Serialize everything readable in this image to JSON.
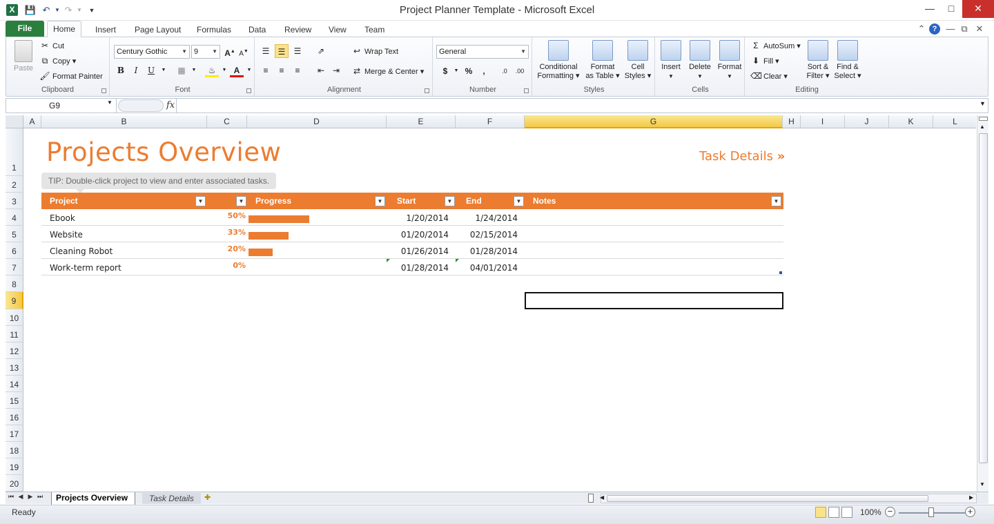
{
  "window": {
    "title": "Project Planner Template  -  Microsoft Excel"
  },
  "ribbon_tabs": [
    "File",
    "Home",
    "Insert",
    "Page Layout",
    "Formulas",
    "Data",
    "Review",
    "View",
    "Team"
  ],
  "clipboard": {
    "paste": "Paste",
    "cut": "Cut",
    "copy": "Copy",
    "format_painter": "Format Painter",
    "label": "Clipboard"
  },
  "font": {
    "name": "Century Gothic",
    "size": "9",
    "label": "Font",
    "bold": "B",
    "italic": "I",
    "underline": "U"
  },
  "alignment": {
    "wrap": "Wrap Text",
    "merge": "Merge & Center",
    "label": "Alignment"
  },
  "number": {
    "format": "General",
    "currency": "$",
    "percent": "%",
    "comma": ",",
    "label": "Number"
  },
  "styles": {
    "conditional": "Conditional",
    "conditional2": "Formatting",
    "format_table": "Format",
    "format_table2": "as Table",
    "cell_styles": "Cell",
    "cell_styles2": "Styles",
    "label": "Styles"
  },
  "cells": {
    "insert": "Insert",
    "delete": "Delete",
    "format": "Format",
    "label": "Cells"
  },
  "editing": {
    "autosum": "AutoSum",
    "fill": "Fill",
    "clear": "Clear",
    "sort": "Sort &",
    "sort2": "Filter",
    "find": "Find &",
    "find2": "Select",
    "label": "Editing"
  },
  "formula_bar": {
    "name_box": "G9",
    "fx": "fx",
    "value": ""
  },
  "columns": [
    "A",
    "B",
    "C",
    "D",
    "E",
    "F",
    "G",
    "H",
    "I",
    "J",
    "K",
    "L"
  ],
  "rows": [
    "1",
    "2",
    "3",
    "4",
    "5",
    "6",
    "7",
    "8",
    "9",
    "10",
    "11",
    "12",
    "13",
    "14",
    "15",
    "16",
    "17",
    "18",
    "19",
    "20"
  ],
  "sheet": {
    "title": "Projects Overview",
    "task_link": "Task Details",
    "task_link_arrow": "»",
    "tip": "TIP: Double-click project to view and enter associated tasks.",
    "headers": {
      "project": "Project",
      "progress": "Progress",
      "start": "Start",
      "end": "End",
      "notes": "Notes"
    },
    "projects": [
      {
        "name": "Ebook",
        "pct_label": "50%",
        "progress": 0.5,
        "start": "1/20/2014",
        "end": "1/24/2014"
      },
      {
        "name": "Website",
        "pct_label": "33%",
        "progress": 0.33,
        "start": "01/20/2014",
        "end": "02/15/2014"
      },
      {
        "name": "Cleaning Robot",
        "pct_label": "20%",
        "progress": 0.2,
        "start": "01/26/2014",
        "end": "01/28/2014"
      },
      {
        "name": "Work-term report",
        "pct_label": "0%",
        "progress": 0.0,
        "start": "01/28/2014",
        "end": "04/01/2014"
      }
    ]
  },
  "sheet_tabs": [
    "Projects Overview",
    "Task Details"
  ],
  "status": {
    "ready": "Ready",
    "zoom": "100%"
  },
  "colors": {
    "accent": "#ec7c30",
    "file_tab": "#2a7f3d",
    "active_header": "#f3c847"
  }
}
